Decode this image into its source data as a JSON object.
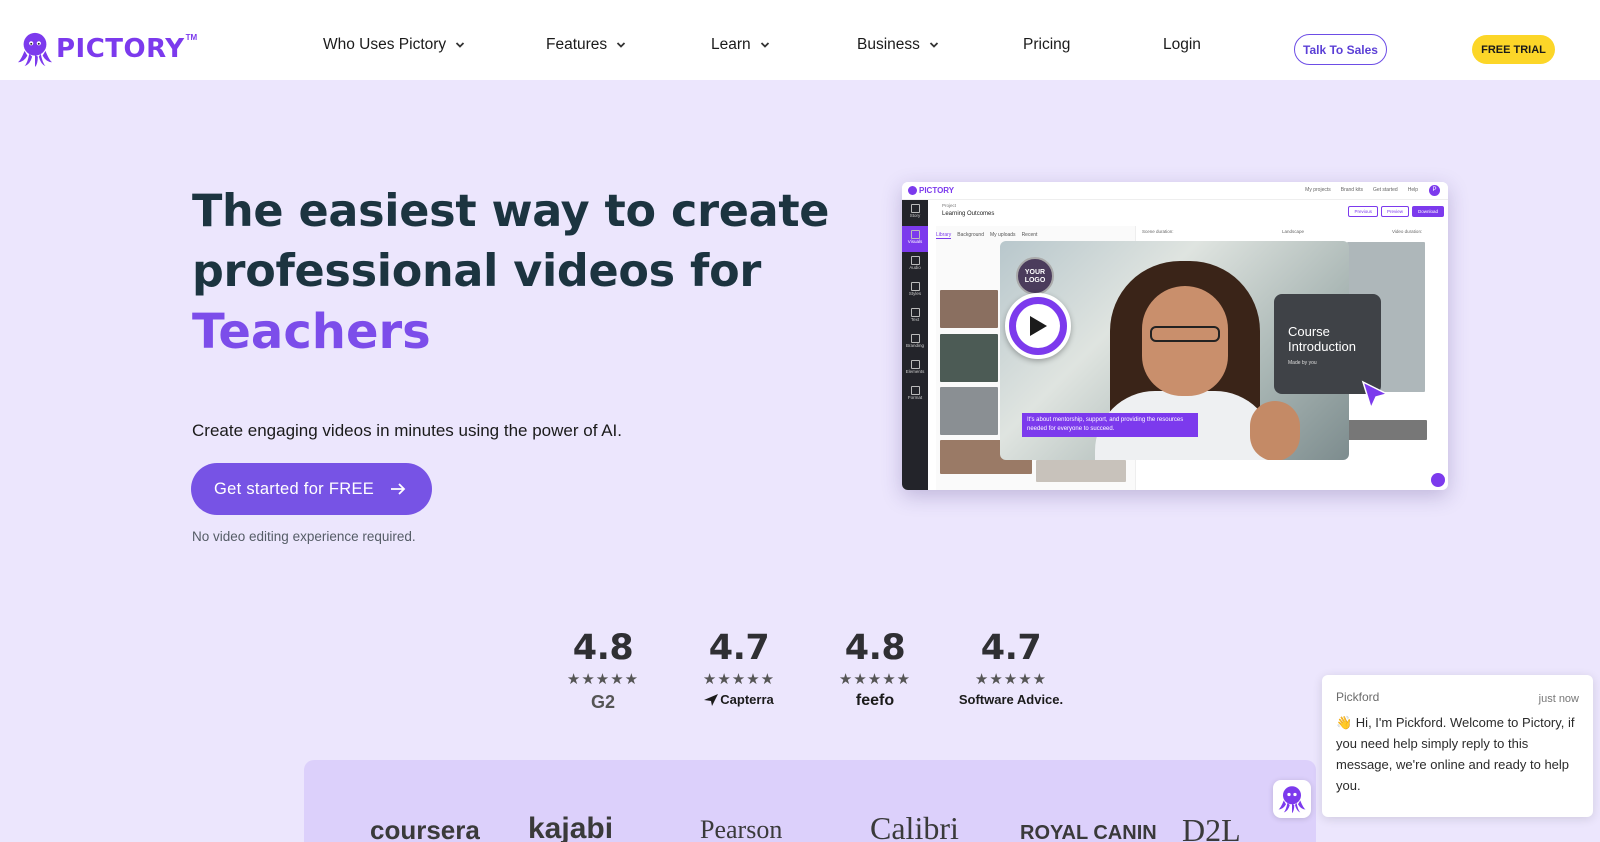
{
  "brand": {
    "name": "PICTORY",
    "tm": "TM",
    "color": "#7c3aed"
  },
  "nav": {
    "items": [
      {
        "label": "Who Uses Pictory",
        "dropdown": true
      },
      {
        "label": "Features",
        "dropdown": true
      },
      {
        "label": "Learn",
        "dropdown": true
      },
      {
        "label": "Business",
        "dropdown": true
      },
      {
        "label": "Pricing",
        "dropdown": false
      },
      {
        "label": "Login",
        "dropdown": false
      }
    ],
    "talk_to_sales": "Talk To Sales",
    "free_trial": "FREE TRIAL"
  },
  "hero": {
    "title": "The easiest way to create professional videos for",
    "accent": "Teachers",
    "subtitle": "Create engaging videos in minutes using the power of AI.",
    "cta": "Get started for FREE",
    "note": "No video editing experience required."
  },
  "mockup": {
    "logo": "PICTORY",
    "top_links": [
      "My projects",
      "Brand kits",
      "Get started",
      "Help"
    ],
    "avatar": "P",
    "project_label": "Project",
    "project_name": "Learning Outcomes",
    "buttons": [
      "Previous",
      "Preview",
      "Download"
    ],
    "sidebar": [
      "Story",
      "Visuals",
      "Audio",
      "Styles",
      "Text",
      "Branding",
      "Elements",
      "Format"
    ],
    "tabs": [
      "Library",
      "Background",
      "My uploads",
      "Recent"
    ],
    "scene_duration": "Scene duration:",
    "landscape": "Landscape",
    "video_duration": "Video duration:",
    "your_logo": "YOUR LOGO",
    "caption": "It's about mentorship, support, and providing the resources needed for everyone to succeed.",
    "course_title": "Course Introduction",
    "course_sub": "Made by you"
  },
  "ratings": [
    {
      "value": "4.8",
      "stars": "★★★★★",
      "source": "G2"
    },
    {
      "value": "4.7",
      "stars": "★★★★★",
      "source": "Capterra"
    },
    {
      "value": "4.8",
      "stars": "★★★★★",
      "source": "feefo"
    },
    {
      "value": "4.7",
      "stars": "★★★★★",
      "source": "Software Advice."
    }
  ],
  "clients": [
    "coursera",
    "kajabi",
    "Pearson",
    "Calibri",
    "ROYAL CANIN",
    "D2L"
  ],
  "chat": {
    "name": "Pickford",
    "time": "just now",
    "message": "👋 Hi, I'm Pickford. Welcome to Pictory, if you need help simply reply to this message, we're online and ready to help you."
  },
  "colors": {
    "accent": "#7753e5",
    "yellow": "#fcd628",
    "hero_bg": "#ece6fd",
    "title": "#1c3440"
  }
}
